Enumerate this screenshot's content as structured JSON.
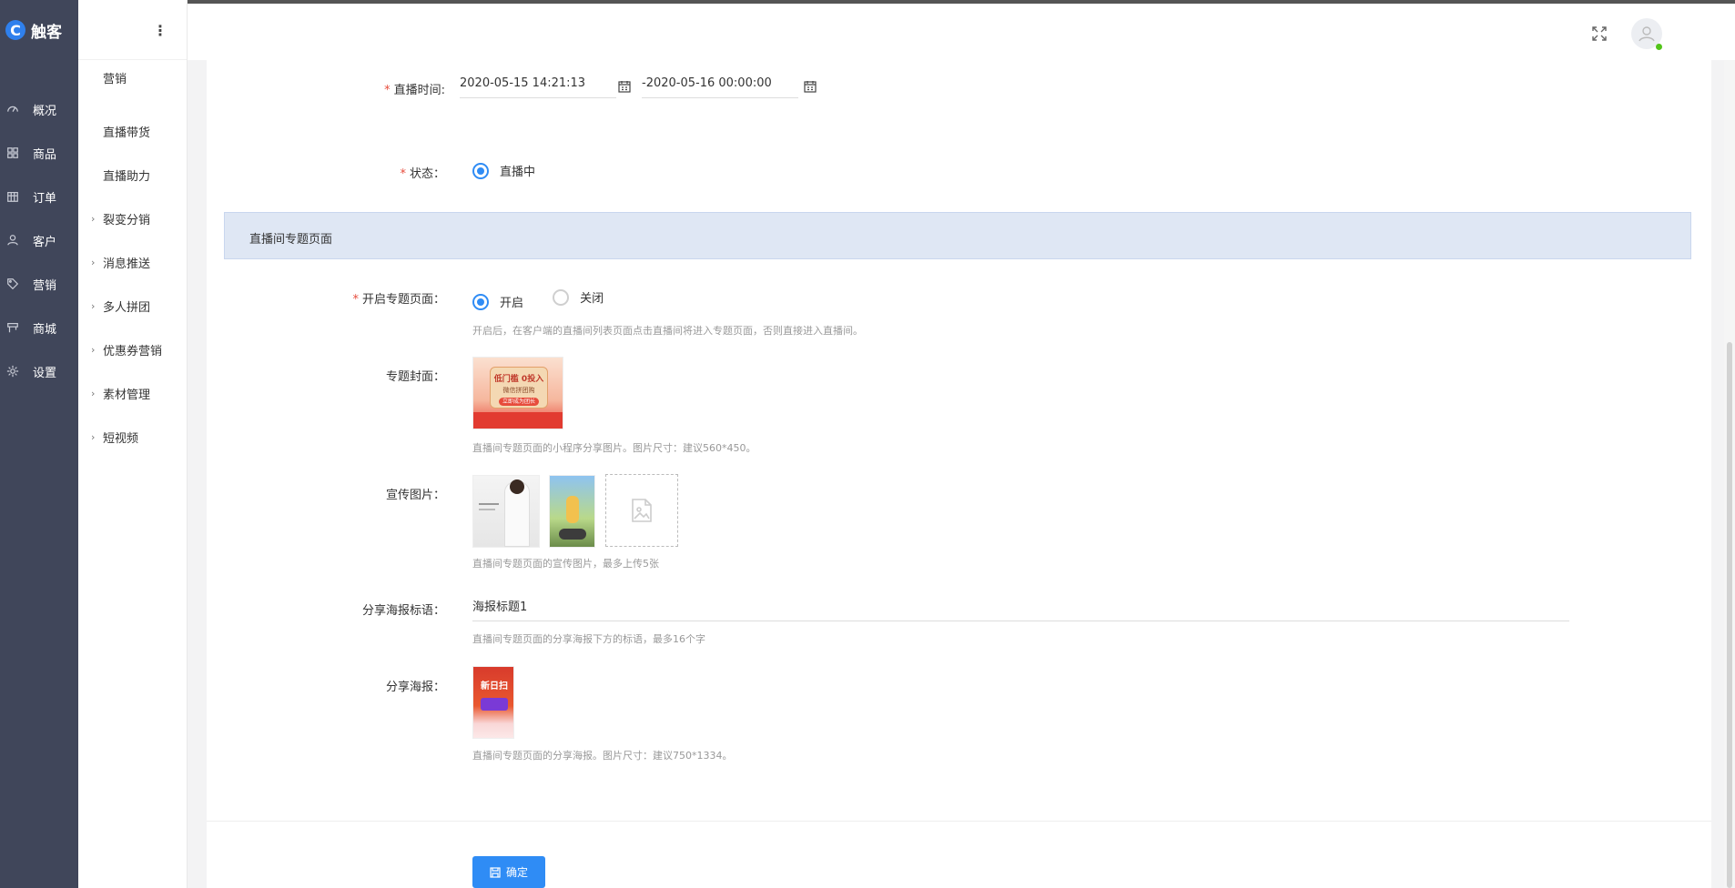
{
  "brand": {
    "name": "触客"
  },
  "nav": {
    "items": [
      {
        "label": "概况",
        "icon": "gauge-icon"
      },
      {
        "label": "商品",
        "icon": "grid-icon"
      },
      {
        "label": "订单",
        "icon": "calendar-icon"
      },
      {
        "label": "客户",
        "icon": "user-icon"
      },
      {
        "label": "营销",
        "icon": "tag-icon"
      },
      {
        "label": "商城",
        "icon": "shop-icon"
      },
      {
        "label": "设置",
        "icon": "gear-icon"
      }
    ]
  },
  "subnav": {
    "title": "营销",
    "items": [
      {
        "label": "直播带货",
        "expandable": false
      },
      {
        "label": "直播助力",
        "expandable": false
      },
      {
        "label": "裂变分销",
        "expandable": true
      },
      {
        "label": "消息推送",
        "expandable": true
      },
      {
        "label": "多人拼团",
        "expandable": true
      },
      {
        "label": "优惠券营销",
        "expandable": true
      },
      {
        "label": "素材管理",
        "expandable": true
      },
      {
        "label": "短视频",
        "expandable": true
      }
    ]
  },
  "form": {
    "live_time": {
      "label": "直播时间:",
      "start": "2020-05-15 14:21:13",
      "end": "-2020-05-16 00:00:00"
    },
    "status": {
      "label": "状态：",
      "option": "直播中"
    },
    "section_title": "直播间专题页面",
    "topic_page": {
      "label": "开启专题页面：",
      "on_label": "开启",
      "off_label": "关闭",
      "hint": "开启后，在客户端的直播间列表页面点击直播间将进入专题页面，否则直接进入直播间。"
    },
    "cover": {
      "label": "专题封面：",
      "hint": "直播间专题页面的小程序分享图片。图片尺寸：建议560*450。",
      "image_text_1": "低门槛 0投入",
      "image_text_2": "微信拼团购",
      "image_text_3": "立即成为团长"
    },
    "promo_images": {
      "label": "宣传图片：",
      "hint": "直播间专题页面的宣传图片，最多上传5张"
    },
    "poster_slogan": {
      "label": "分享海报标语：",
      "value": "海报标题1",
      "hint": "直播间专题页面的分享海报下方的标语，最多16个字"
    },
    "poster": {
      "label": "分享海报：",
      "hint": "直播间专题页面的分享海报。图片尺寸：建议750*1334。",
      "image_text": "新日扫"
    },
    "submit_label": "确定"
  },
  "colors": {
    "accent": "#2f8cf5",
    "nav_bg": "#40465a",
    "section_bg": "#dfe7f4",
    "required": "#e74c3c"
  }
}
